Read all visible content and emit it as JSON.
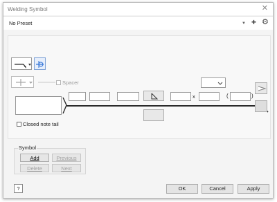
{
  "window": {
    "title": "Welding Symbol",
    "close_icon": "close-icon"
  },
  "preset": {
    "value": "No Preset",
    "add_icon": "plus-icon",
    "settings_icon": "gear-icon"
  },
  "editor": {
    "spacer_label": "Spacer",
    "dimension_separator": "x",
    "paren_open": "(",
    "paren_close": ")",
    "closed_note_tail_label": "Closed note tail",
    "closed_note_tail_checked": false,
    "spacer_checked": false
  },
  "symbol": {
    "group_label": "Symbol",
    "add": "Add",
    "previous": "Previous",
    "delete": "Delete",
    "next": "Next"
  },
  "footer": {
    "ok": "OK",
    "cancel": "Cancel",
    "apply": "Apply",
    "help_icon": "help-icon"
  },
  "colors": {
    "accent": "#2b6fd6",
    "line": "#2a2a2a"
  }
}
